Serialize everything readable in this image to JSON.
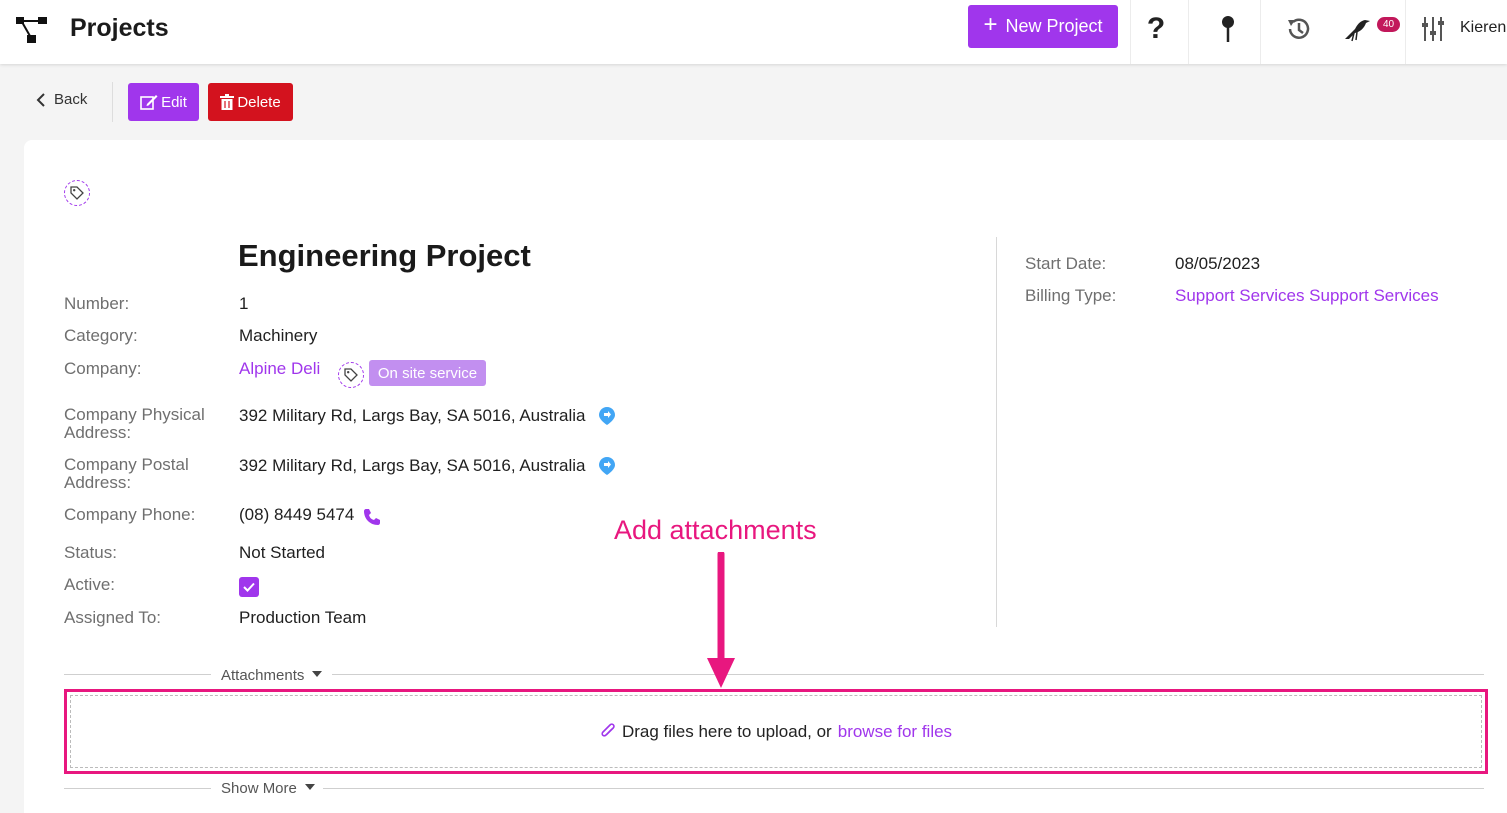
{
  "header": {
    "title": "Projects",
    "new_project_label": "New Project",
    "notification_count": "40",
    "user_name": "Kieren",
    "icons": [
      "logo-icon",
      "help-icon",
      "pin-icon",
      "history-icon",
      "bird-icon",
      "settings-sliders-icon"
    ]
  },
  "actions": {
    "back_label": "Back",
    "edit_label": "Edit",
    "delete_label": "Delete"
  },
  "project": {
    "title": "Engineering Project",
    "fields": {
      "number": {
        "label": "Number:",
        "value": "1"
      },
      "category": {
        "label": "Category:",
        "value": "Machinery"
      },
      "company": {
        "label": "Company:",
        "value": "Alpine Deli",
        "tag": "On site service"
      },
      "physical_address": {
        "label": "Company Physical Address:",
        "value": "392 Military Rd, Largs Bay, SA 5016, Australia"
      },
      "postal_address": {
        "label": "Company Postal Address:",
        "value": "392 Military Rd, Largs Bay, SA 5016, Australia"
      },
      "phone": {
        "label": "Company Phone:",
        "value": "(08) 8449 5474"
      },
      "status": {
        "label": "Status:",
        "value": "Not Started"
      },
      "active": {
        "label": "Active:",
        "checked": true
      },
      "assigned_to": {
        "label": "Assigned To:",
        "value": "Production Team"
      }
    },
    "side": {
      "start_date": {
        "label": "Start Date:",
        "value": "08/05/2023"
      },
      "billing_type": {
        "label": "Billing Type:",
        "value": "Support Services Support Services"
      }
    }
  },
  "attachments": {
    "section_label": "Attachments",
    "drop_text": "Drag files here to upload, or",
    "browse_link": "browse for files",
    "show_more_label": "Show More"
  },
  "annotation": {
    "text": "Add attachments",
    "color": "#e8177f"
  },
  "colors": {
    "accent": "#a036ec",
    "danger": "#d3121e",
    "highlight": "#e8177f"
  }
}
